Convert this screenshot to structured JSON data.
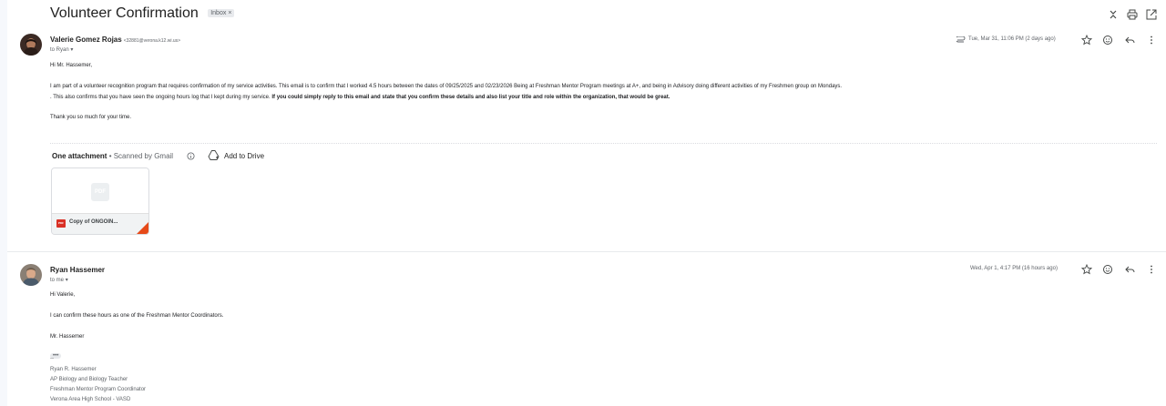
{
  "thread": {
    "subject": "Volunteer Confirmation",
    "label_chip": "Inbox",
    "label_chip_close": "×"
  },
  "message1": {
    "sender_name": "Valerie Gomez Rojas",
    "sender_email": "<32881@verona.k12.wi.us>",
    "to_line": "to Ryan",
    "date": "Tue, Mar 31, 11:06 PM (2 days ago)",
    "greeting": "Hi Mr. Hassemer,",
    "para1_line1": "I am part of a volunteer recognition program that requires confirmation of my service activities. This email is to confirm that I worked 4.5 hours between the dates of 09/25/2025 and 02/23/2026 Being at Freshman Mentor Program meetings at A+, and being in Advisory doing different activities of my Freshmen group on Mondays.",
    "para1_line2_normal": ". This also confirms that you have seen the ongoing hours log that I kept during my service.",
    "para1_line2_bold": "If you could simply reply to this email and state that you confirm these details and also list your title and role within the organization, that would be great.",
    "closing": "Thank you so much for your time.",
    "attachments_header": "One attachment",
    "scanned_by": " • Scanned by Gmail",
    "add_to_drive": "Add to Drive",
    "attachment_preview": "PDF",
    "attachment_type": "PDF",
    "attachment_name": "Copy of ONGOIN..."
  },
  "message2": {
    "sender_name": "Ryan Hassemer",
    "to_line": "to me",
    "date": "Wed, Apr 1, 4:17 PM (16 hours ago)",
    "greeting": "Hi Valerie,",
    "line1": "I can confirm these hours as one of the Freshman Mentor Coordinators.",
    "signoff": "Mr. Hassemer",
    "trimmed": "•••",
    "sig_dash": "--",
    "sig_name": "Ryan R. Hassemer",
    "sig_title1": "AP Biology and Biology Teacher",
    "sig_title2": "Freshman Mentor Program Coordinator",
    "sig_school": "Verona Area High School - VASD"
  },
  "icons": {
    "expand": "expand-all-icon",
    "print": "print-icon",
    "new_window": "open-new-window-icon",
    "attachment": "paperclip-icon",
    "star": "star-icon",
    "emoji": "emoji-react-icon",
    "reply": "reply-icon",
    "more": "more-vert-icon",
    "info": "info-icon",
    "drive": "add-to-drive-icon"
  },
  "colors": {
    "attachment_pdf": "#d93025",
    "accent_fold": "#e64a19"
  }
}
